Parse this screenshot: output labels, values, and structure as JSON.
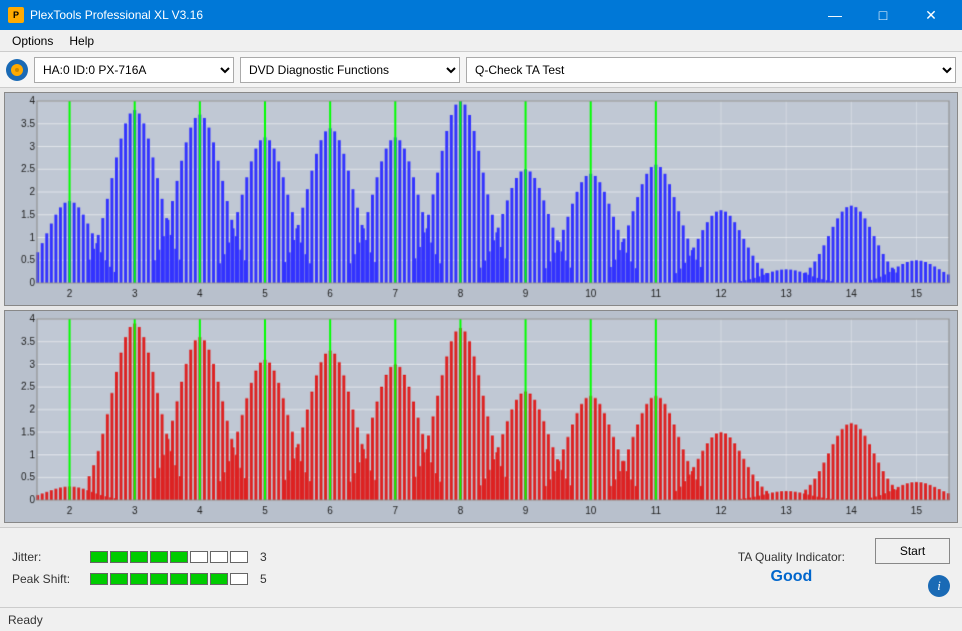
{
  "titleBar": {
    "title": "PlexTools Professional XL V3.16",
    "icon": "P",
    "controls": [
      "minimize",
      "maximize",
      "close"
    ]
  },
  "menuBar": {
    "items": [
      "Options",
      "Help"
    ]
  },
  "toolbar": {
    "driveOptions": [
      "HA:0 ID:0  PX-716A"
    ],
    "driveSelected": "HA:0 ID:0  PX-716A",
    "functionOptions": [
      "DVD Diagnostic Functions"
    ],
    "functionSelected": "DVD Diagnostic Functions",
    "testOptions": [
      "Q-Check TA Test"
    ],
    "testSelected": "Q-Check TA Test"
  },
  "charts": {
    "topChart": {
      "color": "#0000ff",
      "yMax": 4,
      "yLabels": [
        "4",
        "3.5",
        "3",
        "2.5",
        "2",
        "1.5",
        "1",
        "0.5",
        "0"
      ],
      "xLabels": [
        "2",
        "3",
        "4",
        "5",
        "6",
        "7",
        "8",
        "9",
        "10",
        "11",
        "12",
        "13",
        "14",
        "15"
      ]
    },
    "bottomChart": {
      "color": "#ff0000",
      "yMax": 4,
      "yLabels": [
        "4",
        "3.5",
        "3",
        "2.5",
        "2",
        "1.5",
        "1",
        "0.5",
        "0"
      ],
      "xLabels": [
        "2",
        "3",
        "4",
        "5",
        "6",
        "7",
        "8",
        "9",
        "10",
        "11",
        "12",
        "13",
        "14",
        "15"
      ]
    }
  },
  "metrics": {
    "jitter": {
      "label": "Jitter:",
      "filledCells": 5,
      "totalCells": 8,
      "value": "3"
    },
    "peakShift": {
      "label": "Peak Shift:",
      "filledCells": 7,
      "totalCells": 8,
      "value": "5"
    },
    "taQuality": {
      "label": "TA Quality Indicator:",
      "value": "Good"
    }
  },
  "buttons": {
    "start": "Start"
  },
  "statusBar": {
    "text": "Ready"
  }
}
